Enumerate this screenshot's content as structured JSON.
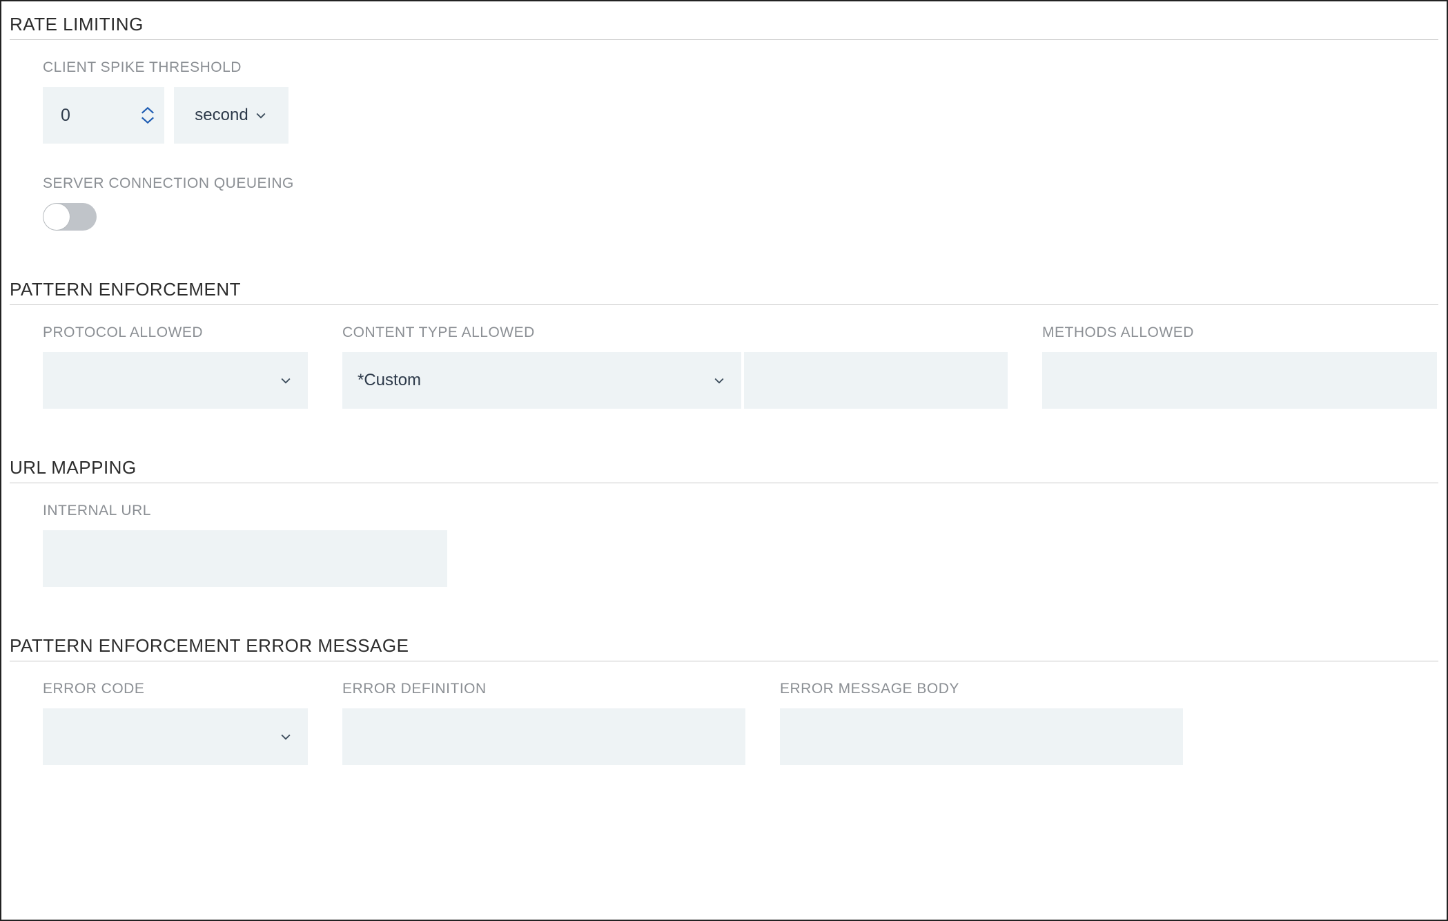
{
  "rate_limiting": {
    "title": "RATE LIMITING",
    "client_spike_label": "CLIENT SPIKE THRESHOLD",
    "client_spike_value": "0",
    "unit_selected": "second",
    "server_conn_label": "SERVER CONNECTION QUEUEING",
    "server_conn_on": false
  },
  "pattern_enforcement": {
    "title": "PATTERN ENFORCEMENT",
    "protocol_label": "PROTOCOL ALLOWED",
    "protocol_value": "",
    "content_type_label": "CONTENT TYPE ALLOWED",
    "content_type_value": "*Custom",
    "content_type_custom": "",
    "methods_label": "METHODS ALLOWED",
    "methods_value": ""
  },
  "url_mapping": {
    "title": "URL MAPPING",
    "internal_url_label": "INTERNAL URL",
    "internal_url_value": ""
  },
  "error_message": {
    "title": "PATTERN ENFORCEMENT ERROR MESSAGE",
    "error_code_label": "ERROR CODE",
    "error_code_value": "",
    "error_def_label": "ERROR DEFINITION",
    "error_def_value": "",
    "error_body_label": "ERROR MESSAGE BODY",
    "error_body_value": ""
  }
}
